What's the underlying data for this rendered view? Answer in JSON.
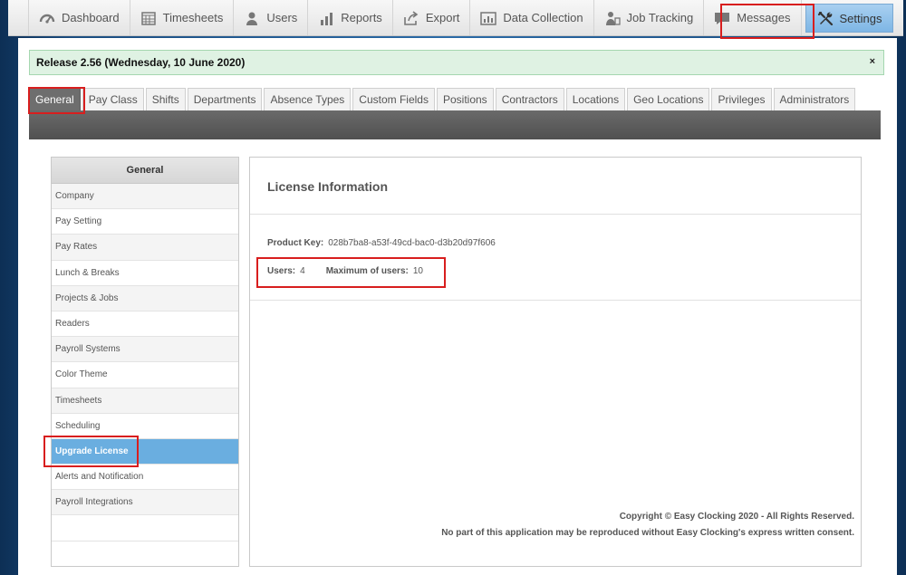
{
  "nav": {
    "items": [
      {
        "label": "Dashboard",
        "icon": "dashboard-icon"
      },
      {
        "label": "Timesheets",
        "icon": "timesheets-icon"
      },
      {
        "label": "Users",
        "icon": "user-icon"
      },
      {
        "label": "Reports",
        "icon": "bar-chart-icon"
      },
      {
        "label": "Export",
        "icon": "export-icon"
      },
      {
        "label": "Data Collection",
        "icon": "data-collection-icon"
      },
      {
        "label": "Job Tracking",
        "icon": "job-tracking-icon"
      },
      {
        "label": "Messages",
        "icon": "message-icon"
      },
      {
        "label": "Settings",
        "icon": "settings-icon",
        "active": true
      }
    ]
  },
  "release": {
    "text": "Release 2.56 (Wednesday, 10 June 2020)",
    "close": "×"
  },
  "tabs": [
    "General",
    "Pay Class",
    "Shifts",
    "Departments",
    "Absence Types",
    "Custom Fields",
    "Positions",
    "Contractors",
    "Locations",
    "Geo Locations",
    "Privileges",
    "Administrators"
  ],
  "sidebar": {
    "header": "General",
    "items": [
      "Company",
      "Pay Setting",
      "Pay Rates",
      "Lunch & Breaks",
      "Projects & Jobs",
      "Readers",
      "Payroll Systems",
      "Color Theme",
      "Timesheets",
      "Scheduling",
      "Upgrade License",
      "Alerts and Notification",
      "Payroll Integrations",
      ""
    ],
    "active": "Upgrade License"
  },
  "license": {
    "title": "License Information",
    "product_key_label": "Product Key:",
    "product_key": "028b7ba8-a53f-49cd-bac0-d3b20d97f606",
    "users_label": "Users:",
    "users": "4",
    "max_users_label": "Maximum of users:",
    "max_users": "10"
  },
  "footer": {
    "copyright": "Copyright © Easy Clocking 2020 - All Rights Reserved.",
    "notice": "No part of this application may be reproduced without Easy Clocking's express written consent."
  },
  "colors": {
    "highlight": "#d81e1e",
    "active_tab": "#6e6e6e",
    "active_sidebar": "#6aaee0",
    "release_bg": "#dff2e3"
  }
}
